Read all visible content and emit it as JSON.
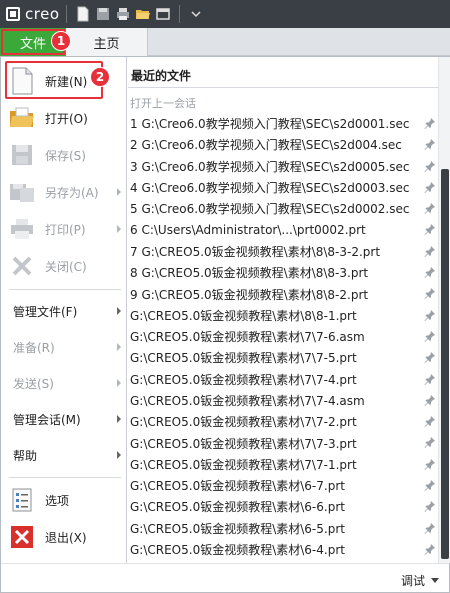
{
  "app": {
    "logo_text": "creo"
  },
  "quick_access": [
    {
      "icon": "new-document-icon"
    },
    {
      "icon": "save-icon"
    },
    {
      "icon": "print-icon"
    },
    {
      "icon": "open-folder-icon"
    },
    {
      "icon": "window-icon"
    },
    {
      "icon": "customize-dropdown-icon"
    }
  ],
  "tabs": {
    "file": "文件",
    "home": "主页"
  },
  "badges": {
    "one": "1",
    "two": "2"
  },
  "menu": {
    "new": "新建(N)",
    "open": "打开(O)",
    "save": "保存(S)",
    "save_as": "另存为(A)",
    "print": "打印(P)",
    "close": "关闭(C)",
    "manage_file": "管理文件(F)",
    "prepare": "准备(R)",
    "send": "发送(S)",
    "manage_session": "管理会话(M)",
    "help": "帮助",
    "options": "选项",
    "exit": "退出(X)"
  },
  "recent": {
    "title": "最近的文件",
    "open_last_session": "打开上一会话",
    "files": [
      "1 G:\\Creo6.0教学视频入门教程\\SEC\\s2d0001.sec",
      "2 G:\\Creo6.0教学视频入门教程\\SEC\\s2d004.sec",
      "3 G:\\Creo6.0教学视频入门教程\\SEC\\s2d0005.sec",
      "4 G:\\Creo6.0教学视频入门教程\\SEC\\s2d0003.sec",
      "5 G:\\Creo6.0教学视频入门教程\\SEC\\s2d0002.sec",
      "6 C:\\Users\\Administrator\\...\\prt0002.prt",
      "7 G:\\CREO5.0钣金视频教程\\素材\\8\\8-3-2.prt",
      "8 G:\\CREO5.0钣金视频教程\\素材\\8\\8-3.prt",
      "9 G:\\CREO5.0钣金视频教程\\素材\\8\\8-2.prt",
      "G:\\CREO5.0钣金视频教程\\素材\\8\\8-1.prt",
      "G:\\CREO5.0钣金视频教程\\素材\\7\\7-6.asm",
      "G:\\CREO5.0钣金视频教程\\素材\\7\\7-5.prt",
      "G:\\CREO5.0钣金视频教程\\素材\\7\\7-4.prt",
      "G:\\CREO5.0钣金视频教程\\素材\\7\\7-4.asm",
      "G:\\CREO5.0钣金视频教程\\素材\\7\\7-2.prt",
      "G:\\CREO5.0钣金视频教程\\素材\\7\\7-3.prt",
      "G:\\CREO5.0钣金视频教程\\素材\\7\\7-1.prt",
      "G:\\CREO5.0钣金视频教程\\素材\\6-7.prt",
      "G:\\CREO5.0钣金视频教程\\素材\\6-6.prt",
      "G:\\CREO5.0钣金视频教程\\素材\\6-5.prt",
      "G:\\CREO5.0钣金视频教程\\素材\\6-4.prt"
    ]
  },
  "footer": {
    "debug": "调试"
  },
  "colors": {
    "accent": "#3aa93a",
    "highlight": "#e8303a",
    "titlebar": "#3a3f46"
  }
}
